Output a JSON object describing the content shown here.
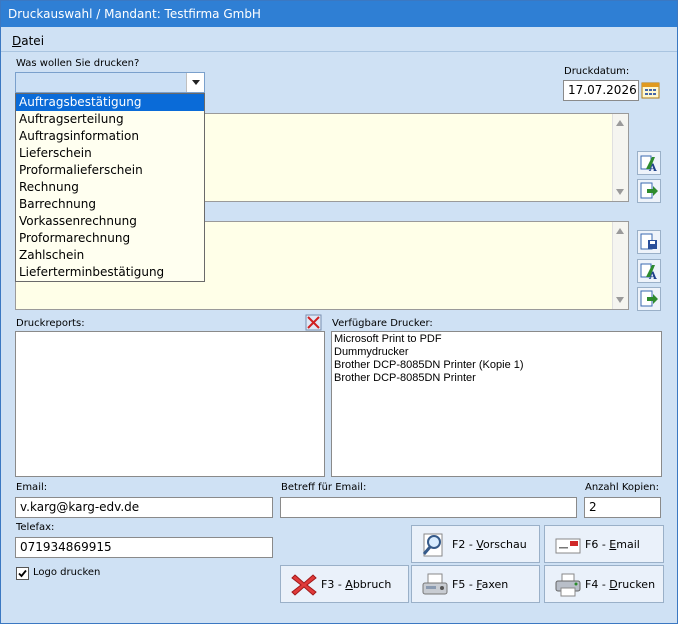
{
  "window": {
    "title": "Druckauswahl / Mandant: Testfirma GmbH"
  },
  "menu": {
    "datei": "Datei"
  },
  "print_what": {
    "label": "Was wollen Sie drucken?",
    "value": "",
    "options": [
      "Auftragsbestätigung",
      "Auftragserteilung",
      "Auftragsinformation",
      "Lieferschein",
      "Proformalieferschein",
      "Rechnung",
      "Barrechnung",
      "Vorkassenrechnung",
      "Proformarechnung",
      "Zahlschein",
      "Lieferterminbestätigung"
    ],
    "selected_index": 0
  },
  "print_date": {
    "label": "Druckdatum:",
    "value": "17.07.2026"
  },
  "reports": {
    "label": "Druckreports:"
  },
  "printers": {
    "label": "Verfügbare Drucker:",
    "items": [
      "Microsoft Print to PDF",
      "Dummydrucker",
      "Brother DCP-8085DN Printer (Kopie 1)",
      "Brother DCP-8085DN Printer"
    ]
  },
  "email": {
    "label": "Email:",
    "value": "v.karg@karg-edv.de"
  },
  "subject": {
    "label": "Betreff für Email:",
    "value": ""
  },
  "copies": {
    "label": "Anzahl Kopien:",
    "value": "2"
  },
  "fax": {
    "label": "Telefax:",
    "value": "071934869915"
  },
  "logo": {
    "label": "Logo drucken",
    "checked": true
  },
  "buttons": {
    "preview": "F2 - Vorschau",
    "email": "F6 - Email",
    "cancel": "F3 - Abbruch",
    "fax": "F5 - Faxen",
    "print": "F4 - Drucken"
  }
}
